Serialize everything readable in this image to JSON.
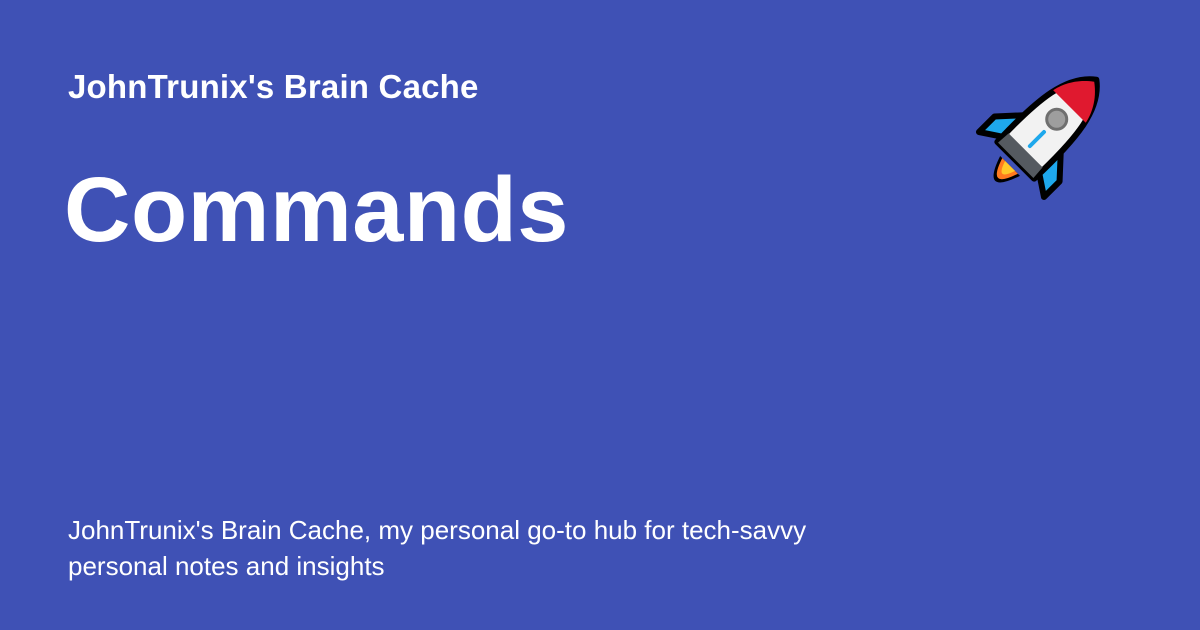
{
  "site": {
    "name": "JohnTrunix's Brain Cache"
  },
  "page": {
    "title": "Commands",
    "description": "JohnTrunix's Brain Cache, my personal go-to hub for tech-savvy personal notes and insights"
  },
  "icons": {
    "logo": "rocket-icon"
  },
  "colors": {
    "background": "#3f51b5",
    "text": "#ffffff",
    "rocket_nose": "#e0192f",
    "rocket_body": "#f2f2f2",
    "rocket_fins": "#1ea8ec",
    "rocket_window": "#9e9e9e",
    "rocket_flame_outer": "#ff7a1f",
    "rocket_flame_inner": "#ffc929"
  }
}
